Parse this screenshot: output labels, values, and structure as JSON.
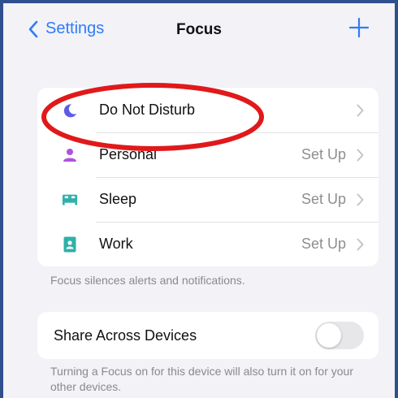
{
  "navbar": {
    "back_label": "Settings",
    "title": "Focus"
  },
  "focus_list": [
    {
      "label": "Do Not Disturb",
      "value": "",
      "icon": "moon-icon",
      "color": "#5e5ce6"
    },
    {
      "label": "Personal",
      "value": "Set Up",
      "icon": "person-icon",
      "color": "#af52de"
    },
    {
      "label": "Sleep",
      "value": "Set Up",
      "icon": "bed-icon",
      "color": "#30b0a8"
    },
    {
      "label": "Work",
      "value": "Set Up",
      "icon": "badge-icon",
      "color": "#30b0a8"
    }
  ],
  "focus_footnote": "Focus silences alerts and notifications.",
  "share": {
    "label": "Share Across Devices",
    "toggle_on": false,
    "footnote": "Turning a Focus on for this device will also turn it on for your other devices."
  },
  "colors": {
    "accent": "#2f7cf6",
    "annotation": "#e0191b"
  }
}
